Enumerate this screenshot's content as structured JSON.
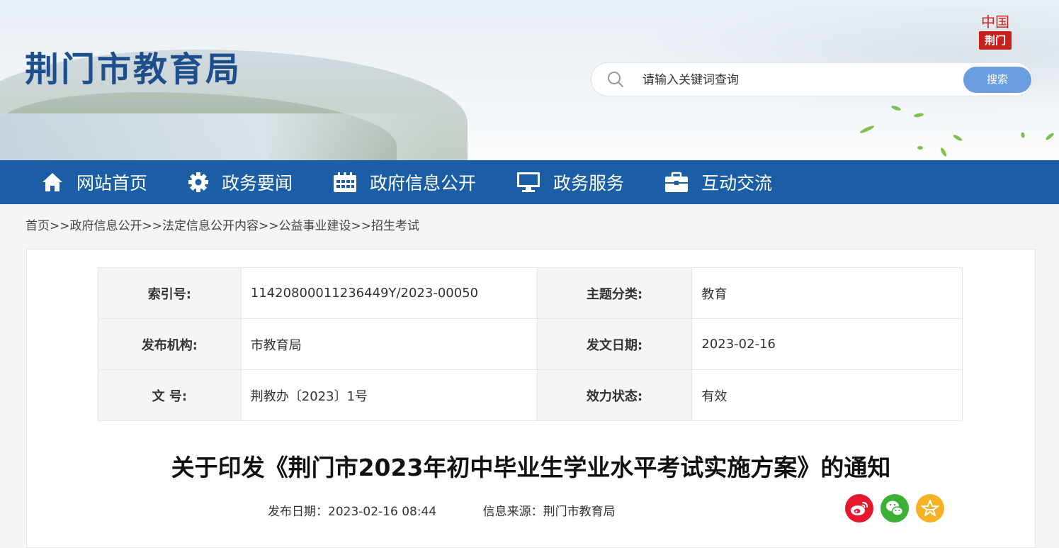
{
  "header": {
    "site_title": "荆门市教育局",
    "seal_top": "中国",
    "seal_bottom": "荆门",
    "search": {
      "placeholder": "请输入关键词查询",
      "button": "搜索"
    }
  },
  "nav": {
    "items": [
      {
        "label": "网站首页",
        "icon": "home-icon"
      },
      {
        "label": "政务要闻",
        "icon": "gear-icon"
      },
      {
        "label": "政府信息公开",
        "icon": "calendar-icon"
      },
      {
        "label": "政务服务",
        "icon": "monitor-icon"
      },
      {
        "label": "互动交流",
        "icon": "briefcase-icon"
      }
    ]
  },
  "breadcrumb": "首页>>政府信息公开>>法定信息公开内容>>公益事业建设>>招生考试",
  "meta": {
    "rows": [
      {
        "k1": "索引号:",
        "v1": "11420800011236449Y/2023-00050",
        "k2": "主题分类:",
        "v2": "教育"
      },
      {
        "k1": "发布机构:",
        "v1": "市教育局",
        "k2": "发文日期:",
        "v2": "2023-02-16"
      },
      {
        "k1": "文 号:",
        "v1": "荆教办〔2023〕1号",
        "k2": "效力状态:",
        "v2": "有效"
      }
    ]
  },
  "article": {
    "title": "关于印发《荆门市2023年初中毕业生学业水平考试实施方案》的通知",
    "date_label": "发布日期：2023-02-16 08:44",
    "source_label": "信息来源：荆门市教育局"
  },
  "share": {
    "items": [
      {
        "name": "weibo-share-icon",
        "color": "#e6162d"
      },
      {
        "name": "wechat-share-icon",
        "color": "#3cb034"
      },
      {
        "name": "favorite-share-icon",
        "color": "#f5b324"
      }
    ]
  }
}
